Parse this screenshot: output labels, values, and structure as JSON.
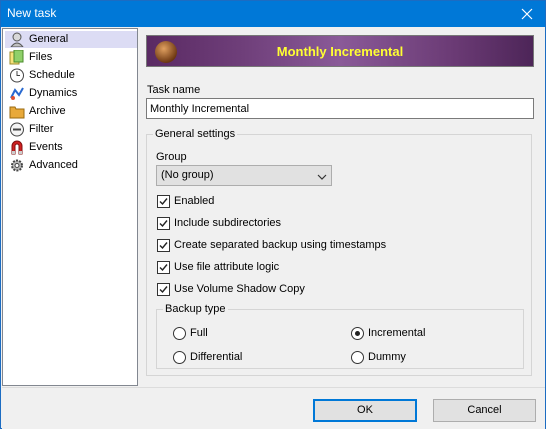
{
  "window": {
    "title": "New task"
  },
  "sidebar": {
    "items": [
      {
        "label": "General",
        "icon": "general-icon",
        "selected": true
      },
      {
        "label": "Files",
        "icon": "files-icon"
      },
      {
        "label": "Schedule",
        "icon": "clock-icon"
      },
      {
        "label": "Dynamics",
        "icon": "dynamics-icon"
      },
      {
        "label": "Archive",
        "icon": "folder-icon"
      },
      {
        "label": "Filter",
        "icon": "filter-icon"
      },
      {
        "label": "Events",
        "icon": "magnet-icon"
      },
      {
        "label": "Advanced",
        "icon": "gear-icon"
      }
    ]
  },
  "banner": {
    "title": "Monthly Incremental",
    "title_color": "#ffff33"
  },
  "task_name": {
    "label": "Task name",
    "value": "Monthly Incremental"
  },
  "general_settings": {
    "title": "General settings",
    "group_label": "Group",
    "group_value": "(No group)",
    "checkboxes": [
      {
        "label": "Enabled",
        "checked": true
      },
      {
        "label": "Include subdirectories",
        "checked": true
      },
      {
        "label": "Create separated backup using timestamps",
        "checked": true
      },
      {
        "label": "Use file attribute logic",
        "checked": true
      },
      {
        "label": "Use Volume Shadow Copy",
        "checked": true
      }
    ],
    "backup_type": {
      "title": "Backup type",
      "options": [
        {
          "label": "Full",
          "selected": false
        },
        {
          "label": "Incremental",
          "selected": true
        },
        {
          "label": "Differential",
          "selected": false
        },
        {
          "label": "Dummy",
          "selected": false
        }
      ]
    }
  },
  "buttons": {
    "ok": "OK",
    "cancel": "Cancel"
  },
  "colors": {
    "titlebar": "#0078d7",
    "selection": "#dcdcf4",
    "default_button_border": "#0078d7"
  }
}
